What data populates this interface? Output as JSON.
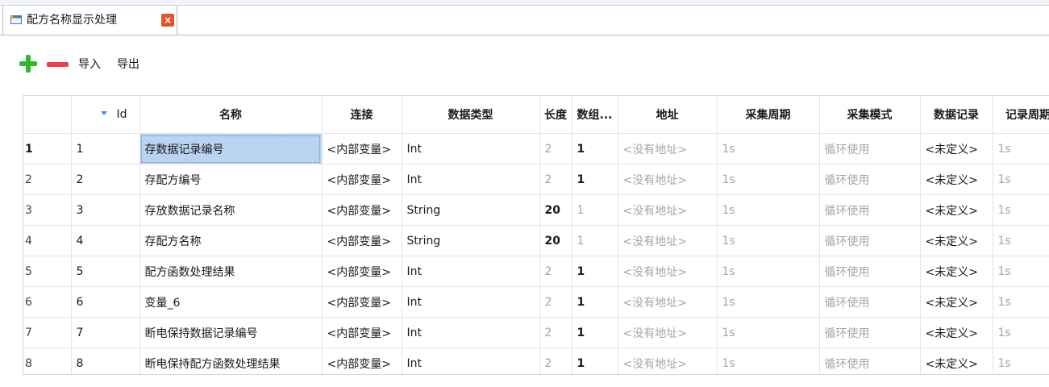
{
  "tab": {
    "label": "配方名称显示处理",
    "close_glyph": "×"
  },
  "toolbar": {
    "import_label": "导入",
    "export_label": "导出"
  },
  "columns": [
    "Id",
    "名称",
    "连接",
    "数据类型",
    "长度",
    "数组...",
    "地址",
    "采集周期",
    "采集模式",
    "数据记录",
    "记录周期"
  ],
  "rows": [
    {
      "rownum": "1",
      "id": "1",
      "name": "存数据记录编号",
      "conn": "<内部变量>",
      "type": "Int",
      "len": "2",
      "arr": "1",
      "addr": "<没有地址>",
      "period": "1s",
      "mode": "循环使用",
      "record": "<未定义>",
      "rperiod": "1s"
    },
    {
      "rownum": "2",
      "id": "2",
      "name": "存配方编号",
      "conn": "<内部变量>",
      "type": "Int",
      "len": "2",
      "arr": "1",
      "addr": "<没有地址>",
      "period": "1s",
      "mode": "循环使用",
      "record": "<未定义>",
      "rperiod": "1s"
    },
    {
      "rownum": "3",
      "id": "3",
      "name": "存放数据记录名称",
      "conn": "<内部变量>",
      "type": "String",
      "len": "20",
      "arr": "1",
      "addr": "<没有地址>",
      "period": "1s",
      "mode": "循环使用",
      "record": "<未定义>",
      "rperiod": "1s"
    },
    {
      "rownum": "4",
      "id": "4",
      "name": "存配方名称",
      "conn": "<内部变量>",
      "type": "String",
      "len": "20",
      "arr": "1",
      "addr": "<没有地址>",
      "period": "1s",
      "mode": "循环使用",
      "record": "<未定义>",
      "rperiod": "1s"
    },
    {
      "rownum": "5",
      "id": "5",
      "name": "配方函数处理结果",
      "conn": "<内部变量>",
      "type": "Int",
      "len": "2",
      "arr": "1",
      "addr": "<没有地址>",
      "period": "1s",
      "mode": "循环使用",
      "record": "<未定义>",
      "rperiod": "1s"
    },
    {
      "rownum": "6",
      "id": "6",
      "name": "变量_6",
      "conn": "<内部变量>",
      "type": "Int",
      "len": "2",
      "arr": "1",
      "addr": "<没有地址>",
      "period": "1s",
      "mode": "循环使用",
      "record": "<未定义>",
      "rperiod": "1s"
    },
    {
      "rownum": "7",
      "id": "7",
      "name": "断电保持数据记录编号",
      "conn": "<内部变量>",
      "type": "Int",
      "len": "2",
      "arr": "1",
      "addr": "<没有地址>",
      "period": "1s",
      "mode": "循环使用",
      "record": "<未定义>",
      "rperiod": "1s"
    },
    {
      "rownum": "8",
      "id": "8",
      "name": "断电保持配方函数处理结果",
      "conn": "<内部变量>",
      "type": "Int",
      "len": "2",
      "arr": "1",
      "addr": "<没有地址>",
      "period": "1s",
      "mode": "循环使用",
      "record": "<未定义>",
      "rperiod": "1s"
    }
  ],
  "colors": {
    "selected_cell": "#b9d3f0",
    "add_icon": "#2eb82e",
    "remove_icon": "#e0464b",
    "close_icon": "#e3542d"
  }
}
